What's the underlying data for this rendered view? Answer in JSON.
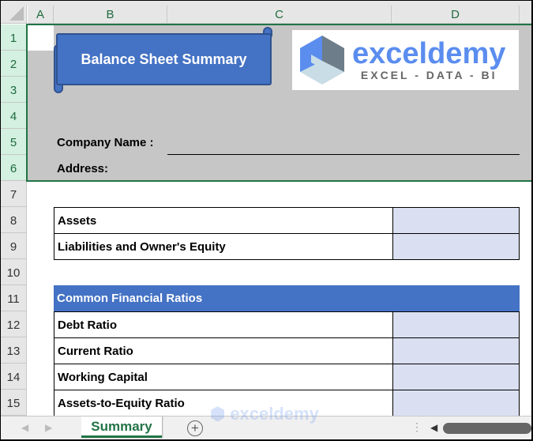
{
  "columns": [
    "A",
    "B",
    "C",
    "D"
  ],
  "rows": [
    "1",
    "2",
    "3",
    "4",
    "5",
    "6",
    "7",
    "8",
    "9",
    "10",
    "11",
    "12",
    "13",
    "14",
    "15"
  ],
  "banner": {
    "title": "Balance Sheet Summary"
  },
  "logo": {
    "name": "exceldemy",
    "tagline": "EXCEL - DATA - BI"
  },
  "form": {
    "company_label": "Company Name :",
    "address_label": "Address:"
  },
  "summary": [
    {
      "label": "Assets",
      "value": ""
    },
    {
      "label": "Liabilities and Owner's Equity",
      "value": ""
    }
  ],
  "ratios": {
    "header": "Common Financial Ratios",
    "items": [
      {
        "label": "Debt Ratio",
        "value": ""
      },
      {
        "label": "Current Ratio",
        "value": ""
      },
      {
        "label": "Working Capital",
        "value": ""
      },
      {
        "label": "Assets-to-Equity Ratio",
        "value": ""
      }
    ]
  },
  "sheet_tabs": [
    {
      "label": "Summary",
      "active": true
    }
  ],
  "colors": {
    "accent": "#4472c4",
    "input_fill": "#dae0f1",
    "header_band": "#c6c6c6",
    "selection": "#217346"
  }
}
